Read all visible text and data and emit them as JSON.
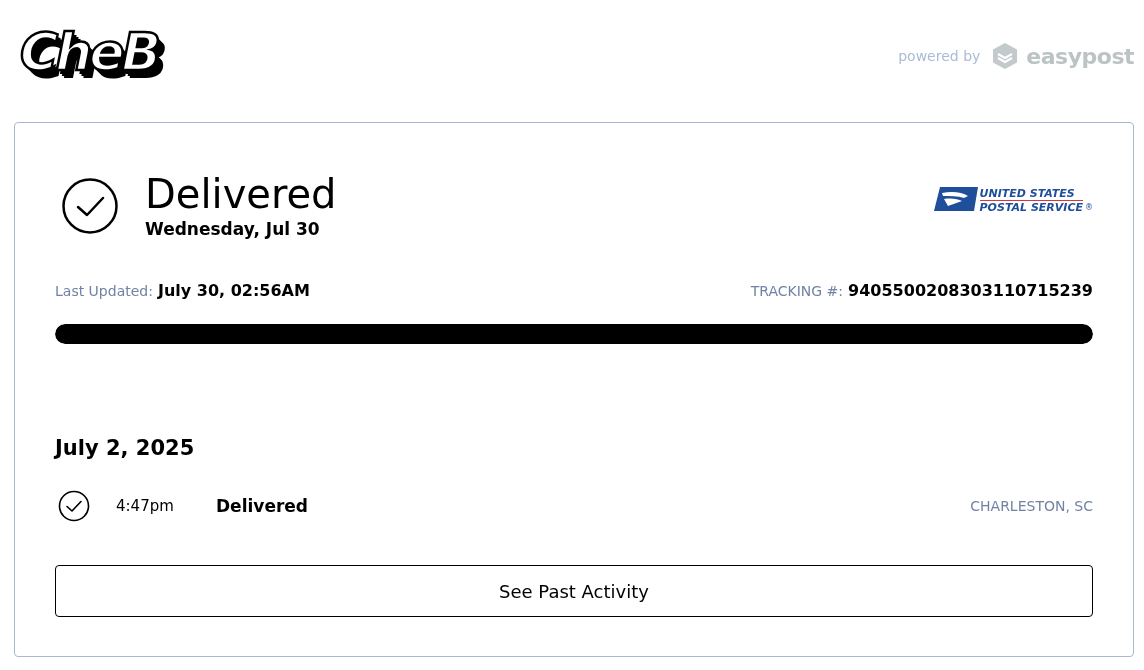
{
  "brand": {
    "logo_text": "CheB",
    "powered_by": "powered by",
    "provider": "easypost"
  },
  "status": {
    "title": "Delivered",
    "date": "Wednesday, Jul 30",
    "delivered": true
  },
  "carrier": {
    "line1": "UNITED STATES",
    "line2": "POSTAL SERVICE",
    "mark": "®"
  },
  "last_updated": {
    "label": "Last Updated:",
    "value": "July 30, 02:56AM"
  },
  "tracking": {
    "label": "TRACKING #:",
    "value": "9405500208303110715239"
  },
  "progress": {
    "level": 1
  },
  "events": [
    {
      "date": "July 2, 2025",
      "items": [
        {
          "time": "4:47pm",
          "status": "Delivered",
          "location": "CHARLESTON, SC",
          "delivered": true
        }
      ]
    }
  ],
  "button": "See Past Activity"
}
